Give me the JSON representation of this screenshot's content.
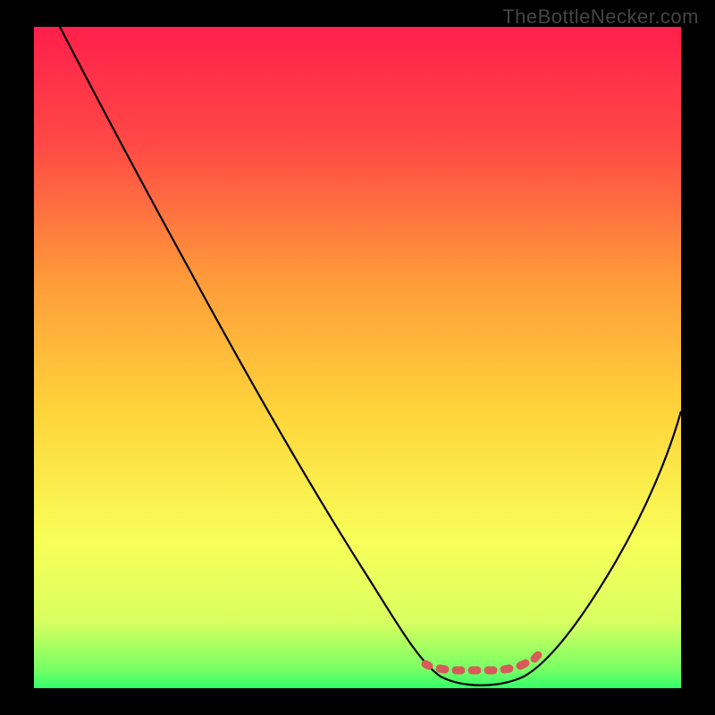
{
  "watermark": "TheBottleNecker.com",
  "chart_data": {
    "type": "line",
    "title": "",
    "xlabel": "",
    "ylabel": "",
    "xlim": [
      0,
      100
    ],
    "ylim": [
      0,
      100
    ],
    "background_gradient": {
      "top": "#ff1f4b",
      "mid1": "#ff7a3a",
      "mid2": "#ffd43a",
      "mid3": "#f8ff5a",
      "bottom": "#32ff6a"
    },
    "series": [
      {
        "name": "bottleneck-curve",
        "color": "#000000",
        "width": 2.2,
        "points": [
          {
            "x": 4,
            "y": 100
          },
          {
            "x": 10,
            "y": 88
          },
          {
            "x": 20,
            "y": 71
          },
          {
            "x": 30,
            "y": 55
          },
          {
            "x": 40,
            "y": 39
          },
          {
            "x": 50,
            "y": 23
          },
          {
            "x": 56,
            "y": 12
          },
          {
            "x": 60,
            "y": 5
          },
          {
            "x": 63,
            "y": 1.5
          },
          {
            "x": 67,
            "y": 0.8
          },
          {
            "x": 72,
            "y": 0.8
          },
          {
            "x": 76,
            "y": 1.5
          },
          {
            "x": 80,
            "y": 5
          },
          {
            "x": 86,
            "y": 14
          },
          {
            "x": 92,
            "y": 26
          },
          {
            "x": 100,
            "y": 44
          }
        ]
      },
      {
        "name": "optimal-zone-marker",
        "color": "#d85a5a",
        "width": 8,
        "style": "dotted",
        "points": [
          {
            "x": 61,
            "y": 4
          },
          {
            "x": 64,
            "y": 3
          },
          {
            "x": 67,
            "y": 3
          },
          {
            "x": 70,
            "y": 3
          },
          {
            "x": 73,
            "y": 3
          },
          {
            "x": 76,
            "y": 3.5
          },
          {
            "x": 78,
            "y": 4.5
          }
        ]
      }
    ]
  }
}
